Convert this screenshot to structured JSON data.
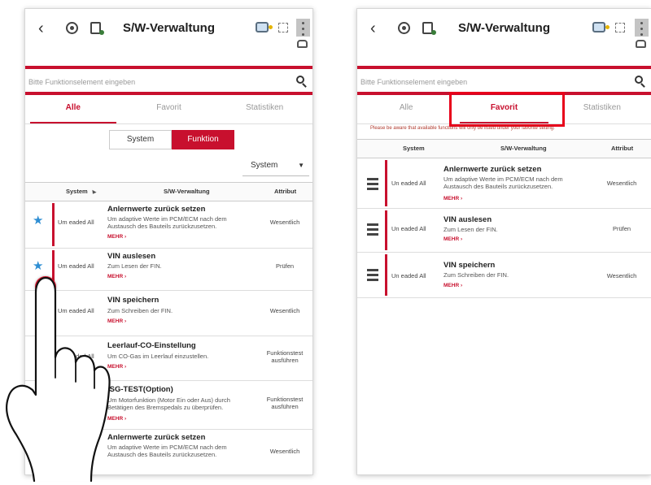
{
  "left": {
    "title": "S/W-Verwaltung",
    "search_placeholder": "Bitte Funktionselement eingeben",
    "tabs": [
      "Alle",
      "Favorit",
      "Statistiken"
    ],
    "toggle": [
      "System",
      "Funktion"
    ],
    "dropdown_value": "System",
    "headers": {
      "system": "System",
      "sw": "S/W-Verwaltung",
      "attr": "Attribut"
    },
    "rows": [
      {
        "system": "Um eaded All",
        "name": "Anlernwerte zurück setzen",
        "desc": "Um adaptive Werte im PCM/ECM nach dem Austausch des Bauteils zurückzusetzen.",
        "more": "MEHR ›",
        "attr": "Wesentlich"
      },
      {
        "system": "Um eaded All",
        "name": "VIN auslesen",
        "desc": "Zum Lesen der FIN.",
        "more": "MEHR ›",
        "attr": "Prüfen"
      },
      {
        "system": "Um eaded All",
        "name": "VIN speichern",
        "desc": "Zum Schreiben der FIN.",
        "more": "MEHR ›",
        "attr": "Wesentlich"
      },
      {
        "system": "Um eaded All",
        "name": "Leerlauf-CO-Einstellung",
        "desc": "Um CO-Gas im Leerlauf einzustellen.",
        "more": "MEHR ›",
        "attr": "Funktionstest ausführen"
      },
      {
        "system": "Um eaded All",
        "name": "ISG-TEST(Option)",
        "desc": "Um Motorfunktion (Motor Ein oder Aus) durch Betätigen des Bremspedals zu überprüfen.",
        "more": "MEHR ›",
        "attr": "Funktionstest ausführen"
      },
      {
        "system": "",
        "name": "Anlernwerte zurück setzen",
        "desc": "Um adaptive Werte im PCM/ECM nach dem Austausch des Bauteils zurückzusetzen.",
        "more": "",
        "attr": "Wesentlich"
      }
    ]
  },
  "right": {
    "title": "S/W-Verwaltung",
    "search_placeholder": "Bitte Funktionselement eingeben",
    "tabs": [
      "Alle",
      "Favorit",
      "Statistiken"
    ],
    "notice": "Please be aware that available functions will only be listed under your favorite setting.",
    "headers": {
      "system": "System",
      "sw": "S/W-Verwaltung",
      "attr": "Attribut"
    },
    "rows": [
      {
        "system": "Un eaded All",
        "name": "Anlernwerte zurück setzen",
        "desc": "Um adaptive Werte im PCM/ECM nach dem Austausch des Bauteils zurückzusetzen.",
        "more": "MEHR ›",
        "attr": "Wesentlich"
      },
      {
        "system": "Un eaded All",
        "name": "VIN auslesen",
        "desc": "Zum Lesen der FIN.",
        "more": "MEHR ›",
        "attr": "Prüfen"
      },
      {
        "system": "Un eaded All",
        "name": "VIN speichern",
        "desc": "Zum Schreiben der FIN.",
        "more": "MEHR ›",
        "attr": "Wesentlich"
      }
    ]
  },
  "colors": {
    "accent": "#c8102e",
    "star": "#2e8ed3",
    "highlight": "#e8001a"
  },
  "icons": [
    "back-icon",
    "diagnostic-icon",
    "battery-icon",
    "vehicle-info-icon",
    "fullscreen-icon",
    "overflow-menu-icon",
    "car-icon",
    "search-icon",
    "star-icon",
    "drag-handle-icon",
    "hand-pointer-icon"
  ]
}
